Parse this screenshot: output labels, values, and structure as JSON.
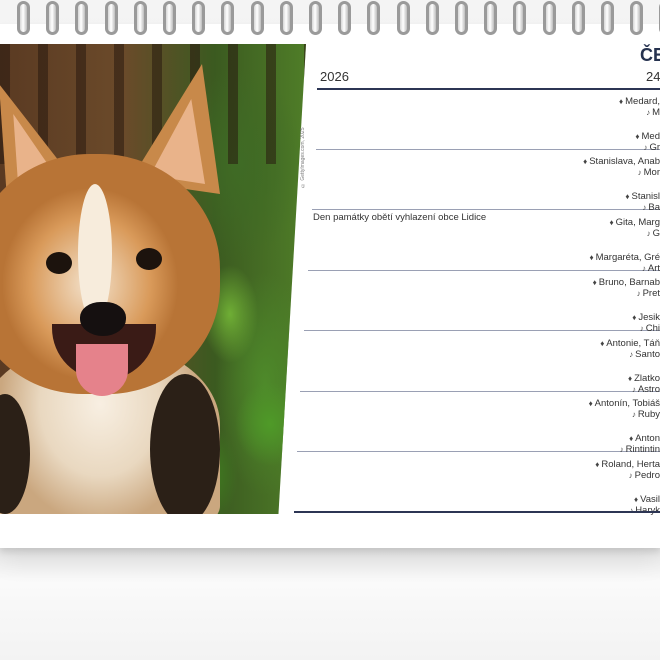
{
  "calendar": {
    "month_partial": "ČE",
    "year": "2026",
    "week_partial": "24",
    "photo_credit": "© GettyImages.com, 2025",
    "holiday": "Den památky obětí vyhlazení obce Lidice",
    "days": [
      {
        "name": "Medard,",
        "animal": "M"
      },
      {
        "name": "Med",
        "animal": "Gr"
      },
      {
        "name": "Stanislava, Anab",
        "animal": "Mor"
      },
      {
        "name": "Stanisl",
        "animal": "Ba"
      },
      {
        "name": "Gita, Marg",
        "animal": "G"
      },
      {
        "name": "Margaréta, Gré",
        "animal": "Art"
      },
      {
        "name": "Bruno, Barnab",
        "animal": "Pret"
      },
      {
        "name": "Jesik",
        "animal": "Chi"
      },
      {
        "name": "Antonie, Táň",
        "animal": "Santo"
      },
      {
        "name": "Zlatko",
        "animal": "Astro"
      },
      {
        "name": "Antonín, Tobiáš",
        "animal": "Ruby"
      },
      {
        "name": "Anton",
        "animal": "Rintintin"
      },
      {
        "name": "Roland, Herta",
        "animal": "Pedro"
      },
      {
        "name": "Vasil",
        "animal": "Haryk"
      }
    ]
  }
}
